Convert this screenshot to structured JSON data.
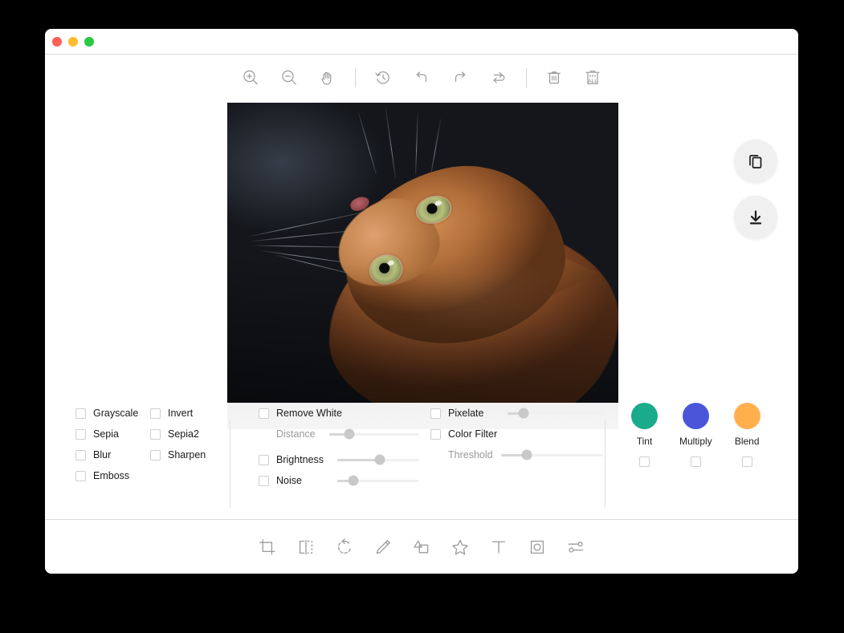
{
  "window": {
    "traffic_lights": [
      {
        "name": "close",
        "color": "#ff5f57"
      },
      {
        "name": "minimize",
        "color": "#febc2e"
      },
      {
        "name": "maximize",
        "color": "#28c840"
      }
    ]
  },
  "top_toolbar": {
    "items": [
      {
        "name": "zoom-in-icon",
        "label": "Zoom In"
      },
      {
        "name": "zoom-out-icon",
        "label": "Zoom Out"
      },
      {
        "name": "hand-icon",
        "label": "Hand"
      },
      {
        "name": "divider",
        "label": ""
      },
      {
        "name": "history-icon",
        "label": "History"
      },
      {
        "name": "undo-icon",
        "label": "Undo"
      },
      {
        "name": "redo-icon",
        "label": "Redo"
      },
      {
        "name": "reset-icon",
        "label": "Reset"
      },
      {
        "name": "divider",
        "label": ""
      },
      {
        "name": "delete-icon",
        "label": "Delete"
      },
      {
        "name": "delete-all-icon",
        "label": "Delete All"
      }
    ],
    "delete_all_text": "ALL"
  },
  "floating_buttons": [
    {
      "name": "copy-button",
      "label": "Copy"
    },
    {
      "name": "download-button",
      "label": "Download"
    }
  ],
  "canvas": {
    "image_alt": "Ginger cat looking upward on dark background"
  },
  "filters": {
    "basic": [
      {
        "label": "Grayscale",
        "checked": false
      },
      {
        "label": "Invert",
        "checked": false
      },
      {
        "label": "Sepia",
        "checked": false
      },
      {
        "label": "Sepia2",
        "checked": false
      },
      {
        "label": "Blur",
        "checked": false
      },
      {
        "label": "Sharpen",
        "checked": false
      },
      {
        "label": "Emboss",
        "checked": false
      }
    ],
    "middle": {
      "remove_white": {
        "label": "Remove White",
        "checked": false
      },
      "distance": {
        "label": "Distance",
        "value": 22
      },
      "brightness": {
        "label": "Brightness",
        "checked": false,
        "value": 52
      },
      "noise": {
        "label": "Noise",
        "checked": false,
        "value": 20
      }
    },
    "right": {
      "pixelate": {
        "label": "Pixelate",
        "checked": false,
        "value": 17
      },
      "color_filter": {
        "label": "Color Filter",
        "checked": false
      },
      "threshold": {
        "label": "Threshold",
        "value": 25
      }
    },
    "blend": [
      {
        "label": "Tint",
        "color": "#1aab8a",
        "checked": false
      },
      {
        "label": "Multiply",
        "color": "#4a55da",
        "checked": false
      },
      {
        "label": "Blend",
        "color": "#ffb04d",
        "checked": false
      }
    ]
  },
  "bottom_toolbar": {
    "items": [
      {
        "name": "crop-icon",
        "label": "Crop"
      },
      {
        "name": "flip-icon",
        "label": "Flip"
      },
      {
        "name": "rotate-icon",
        "label": "Rotate"
      },
      {
        "name": "draw-icon",
        "label": "Draw"
      },
      {
        "name": "shape-icon",
        "label": "Shape"
      },
      {
        "name": "star-icon",
        "label": "Icon"
      },
      {
        "name": "text-icon",
        "label": "Text"
      },
      {
        "name": "mask-icon",
        "label": "Mask"
      },
      {
        "name": "filter-icon",
        "label": "Filter"
      }
    ]
  }
}
